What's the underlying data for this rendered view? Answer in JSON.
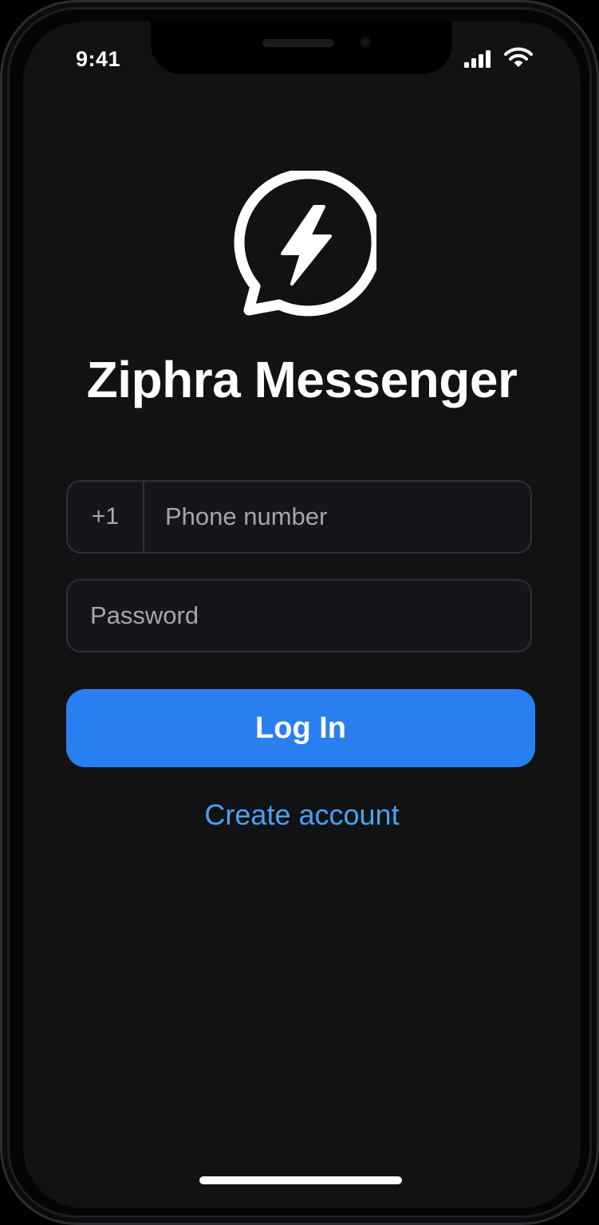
{
  "status_bar": {
    "time": "9:41",
    "icons": [
      "cellular-signal-icon",
      "wifi-icon"
    ]
  },
  "app": {
    "logo_icon": "chat-bubble-lightning-icon",
    "name": "Ziphra Messenger"
  },
  "login_form": {
    "country_code": "+1",
    "phone_placeholder": "Phone number",
    "password_placeholder": "Password",
    "login_label": "Log In",
    "create_account_label": "Create account"
  },
  "colors": {
    "background": "#111214",
    "primary_button": "#2a7ff0",
    "link": "#4aa1f4",
    "field_border": "#2e3035"
  }
}
